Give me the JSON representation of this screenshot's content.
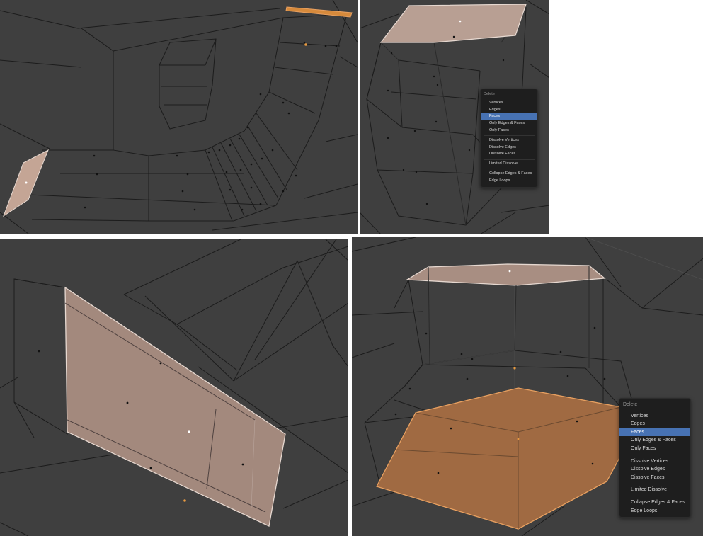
{
  "colors": {
    "viewport_bg": "#3f3f3f",
    "selected_face": "#c8a898",
    "selected_face_orange": "#b77a4b",
    "active_item": "#4772b3",
    "menu_bg": "#1e1e1e"
  },
  "panels": [
    {
      "name": "viewport-edge-selected"
    },
    {
      "name": "viewport-delete-menu-small"
    },
    {
      "name": "viewport-face-selected"
    },
    {
      "name": "viewport-delete-menu-large"
    }
  ],
  "delete_menu_small": {
    "title": "Delete",
    "groups": [
      [
        "Vertices",
        "Edges",
        "Faces",
        "Only Edges & Faces",
        "Only Faces"
      ],
      [
        "Dissolve Vertices",
        "Dissolve Edges",
        "Dissolve Faces"
      ],
      [
        "Limited Dissolve"
      ],
      [
        "Collapse Edges & Faces",
        "Edge Loops"
      ]
    ],
    "active_item": "Faces"
  },
  "delete_menu_large": {
    "title": "Delete",
    "groups": [
      [
        "Vertices",
        "Edges",
        "Faces",
        "Only Edges & Faces",
        "Only Faces"
      ],
      [
        "Dissolve Vertices",
        "Dissolve Edges",
        "Dissolve Faces"
      ],
      [
        "Limited Dissolve"
      ],
      [
        "Collapse Edges & Faces",
        "Edge Loops"
      ]
    ],
    "active_item": "Faces"
  }
}
